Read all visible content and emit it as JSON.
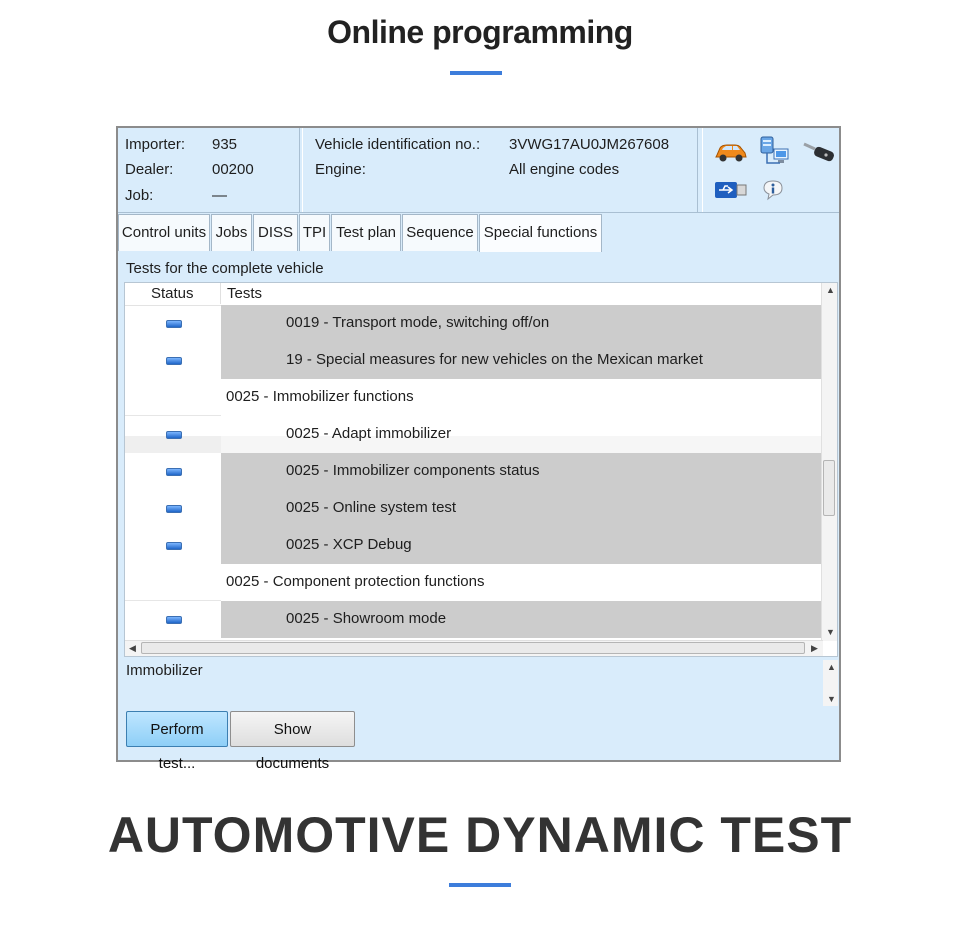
{
  "page_title": "Online programming",
  "bottom_title": "AUTOMOTIVE DYNAMIC TEST",
  "colors": {
    "accent": "#3d7ddb",
    "window_bg": "#d9ecfb",
    "selected_row": "#cccccc"
  },
  "info": {
    "importer_label": "Importer:",
    "importer_value": "935",
    "dealer_label": "Dealer:",
    "dealer_value": "00200",
    "job_label": "Job:",
    "job_value": "—",
    "vin_label": "Vehicle identification no.:",
    "vin_value": "3VWG17AU0JM267608",
    "engine_label": "Engine:",
    "engine_value": "All engine codes"
  },
  "icons": [
    "car-icon",
    "server-network-icon",
    "key-icon",
    "usb-icon",
    "info-icon"
  ],
  "tabs": [
    {
      "label": "Control units"
    },
    {
      "label": "Jobs"
    },
    {
      "label": "DISS"
    },
    {
      "label": "TPI"
    },
    {
      "label": "Test plan"
    },
    {
      "label": "Sequence"
    },
    {
      "label": "Special functions",
      "active": true
    }
  ],
  "section_label": "Tests for the complete vehicle",
  "grid": {
    "headers": {
      "status": "Status",
      "tests": "Tests"
    },
    "rows": [
      {
        "text": "0019 - Transport mode, switching off/on",
        "level": 1,
        "status": true,
        "shaded": true
      },
      {
        "text": "19 - Special measures for new vehicles on the Mexican market",
        "level": 1,
        "status": true,
        "shaded": true
      },
      {
        "text": "0025 - Immobilizer functions",
        "level": 0,
        "status": false,
        "shaded": false
      },
      {
        "text": "0025 - Adapt immobilizer",
        "level": 1,
        "status": true,
        "shaded": false
      },
      {
        "text": "0025 - Immobilizer components status",
        "level": 1,
        "status": true,
        "shaded": true
      },
      {
        "text": "0025 - Online system test",
        "level": 1,
        "status": true,
        "shaded": true
      },
      {
        "text": "0025 - XCP Debug",
        "level": 1,
        "status": true,
        "shaded": true
      },
      {
        "text": "0025 - Component protection functions",
        "level": 0,
        "status": false,
        "shaded": false
      },
      {
        "text": "0025 - Showroom mode",
        "level": 1,
        "status": true,
        "shaded": true
      }
    ]
  },
  "detail_text": "Immobilizer",
  "buttons": {
    "perform": "Perform test...",
    "documents": "Show documents"
  }
}
